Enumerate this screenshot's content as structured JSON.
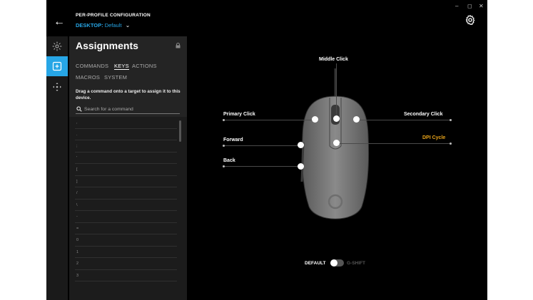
{
  "header": {
    "title": "PER-PROFILE CONFIGURATION",
    "profile_prefix": "DESKTOP:",
    "profile_name": "Default",
    "window_controls": [
      "–",
      "◻",
      "✕"
    ]
  },
  "rail": {
    "items": [
      "lighting-icon",
      "assignments-icon",
      "dpi-icon"
    ],
    "active": "assignments-icon"
  },
  "panel": {
    "title": "Assignments",
    "tabs": [
      "COMMANDS",
      "KEYS",
      "ACTIONS",
      "MACROS",
      "SYSTEM"
    ],
    "active_tab": "KEYS",
    "hint": "Drag a command onto a target to assign it to this device.",
    "search_placeholder": "Search for a command",
    "keys": [
      ",",
      ".",
      ";",
      "'",
      "[",
      "]",
      "/",
      "\\",
      "-",
      "=",
      "0",
      "1",
      "2",
      "3"
    ]
  },
  "mouse": {
    "labels": {
      "middle": "Middle Click",
      "primary": "Primary Click",
      "secondary": "Secondary Click",
      "forward": "Forward",
      "dpi": "DPI Cycle",
      "back": "Back"
    }
  },
  "toggle": {
    "left": "DEFAULT",
    "right": "G-SHIFT",
    "state": "DEFAULT"
  },
  "colors": {
    "accent": "#27a6e6",
    "highlight": "#e8a319",
    "background": "#000000",
    "panel": "#242424"
  }
}
